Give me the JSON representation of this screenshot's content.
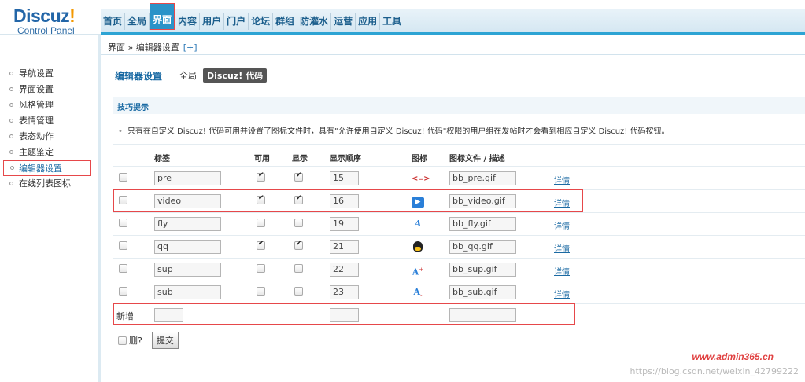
{
  "logo": {
    "main": "Discuz",
    "bang": "!",
    "sub": "Control Panel"
  },
  "nav": [
    "首页",
    "全局",
    "界面",
    "内容",
    "用户",
    "门户",
    "论坛",
    "群组",
    "防灌水",
    "运营",
    "应用",
    "工具"
  ],
  "nav_active_index": 2,
  "breadcrumb": {
    "path": "界面 » 编辑器设置",
    "plus": "[+]"
  },
  "sidebar": [
    "导航设置",
    "界面设置",
    "风格管理",
    "表情管理",
    "表态动作",
    "主题鉴定",
    "编辑器设置",
    "在线列表图标"
  ],
  "sidebar_active_index": 6,
  "page": {
    "title": "编辑器设置",
    "subnav_all": "全局",
    "subnav_code": "Discuz! 代码"
  },
  "tips": {
    "title": "技巧提示",
    "text": "只有在自定义 Discuz! 代码可用并设置了图标文件时，具有\"允许使用自定义 Discuz! 代码\"权限的用户组在发帖时才会看到相应自定义 Discuz! 代码按钮。"
  },
  "table": {
    "headers": {
      "tag": "标签",
      "available": "可用",
      "display": "显示",
      "order": "显示顺序",
      "icon": "图标",
      "icon_file": "图标文件 / 描述"
    },
    "detail_label": "详情",
    "rows": [
      {
        "tag": "pre",
        "available": true,
        "display": true,
        "order": "15",
        "icon": "pre-icon",
        "icon_file": "bb_pre.gif"
      },
      {
        "tag": "video",
        "available": true,
        "display": true,
        "order": "16",
        "icon": "video-icon",
        "icon_file": "bb_video.gif"
      },
      {
        "tag": "fly",
        "available": false,
        "display": false,
        "order": "19",
        "icon": "fly-icon",
        "icon_file": "bb_fly.gif"
      },
      {
        "tag": "qq",
        "available": true,
        "display": true,
        "order": "21",
        "icon": "qq-icon",
        "icon_file": "bb_qq.gif"
      },
      {
        "tag": "sup",
        "available": false,
        "display": false,
        "order": "22",
        "icon": "sup-icon",
        "icon_file": "bb_sup.gif"
      },
      {
        "tag": "sub",
        "available": false,
        "display": false,
        "order": "23",
        "icon": "sub-icon",
        "icon_file": "bb_sub.gif"
      }
    ],
    "new_label": "新增"
  },
  "footer": {
    "delete_label": "删?",
    "submit_label": "提交"
  },
  "watermark": {
    "text": "www.admin365.cn",
    "url": "https://blog.csdn.net/weixin_42799222"
  }
}
